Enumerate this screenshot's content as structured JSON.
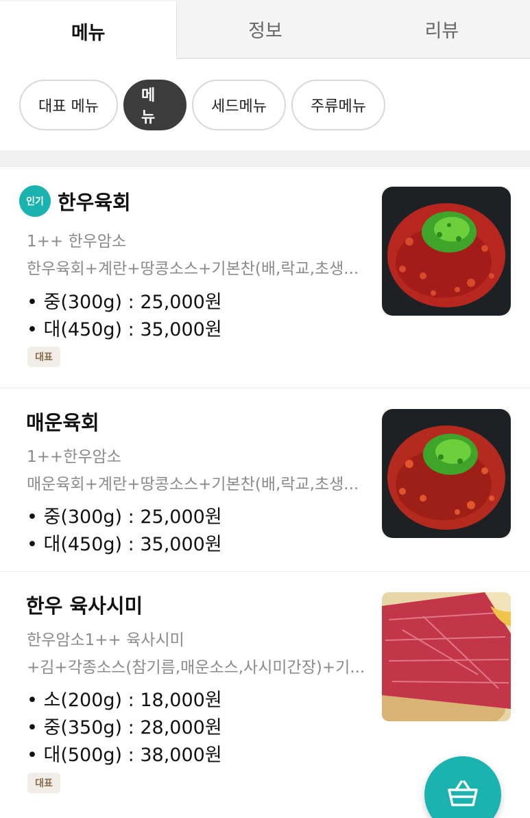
{
  "tabs": [
    {
      "label": "메뉴",
      "active": true
    },
    {
      "label": "정보",
      "active": false
    },
    {
      "label": "리뷰",
      "active": false
    }
  ],
  "categories": [
    {
      "label": "대표 메뉴",
      "active": false
    },
    {
      "label": "메뉴",
      "active": true
    },
    {
      "label": "세드메뉴",
      "active": false
    },
    {
      "label": "주류메뉴",
      "active": false
    }
  ],
  "menu": [
    {
      "badge": "인기",
      "name": "한우육회",
      "subtitle": "1++ 한우암소",
      "description": "한우육회+계란+땅콩소스+기본찬(배,락교,초생...",
      "prices": [
        "• 중(300g) : 25,000원",
        "• 대(450g) : 35,000원"
      ],
      "tag": "대표"
    },
    {
      "name": "매운육회",
      "subtitle": "1++한우암소",
      "description": "매운육회+계란+땅콩소스+기본찬(배,락교,초생...",
      "prices": [
        "• 중(300g) : 25,000원",
        "• 대(450g) : 35,000원"
      ]
    },
    {
      "name": "한우 육사시미",
      "subtitle": "한우암소1++ 육사시미",
      "description": "+김+각종소스(참기름,매운소스,사시미간장)+기...",
      "prices": [
        "• 소(200g) : 18,000원",
        "• 중(350g) : 28,000원",
        "• 대(500g) : 38,000원"
      ],
      "tag": "대표"
    }
  ],
  "icons": {
    "cart": "shopping-basket-icon"
  },
  "colors": {
    "accent": "#1bb3b0",
    "active_chip": "#3c3c3c",
    "tag_bg": "#f1ede8",
    "tag_text": "#8b6b4a"
  }
}
